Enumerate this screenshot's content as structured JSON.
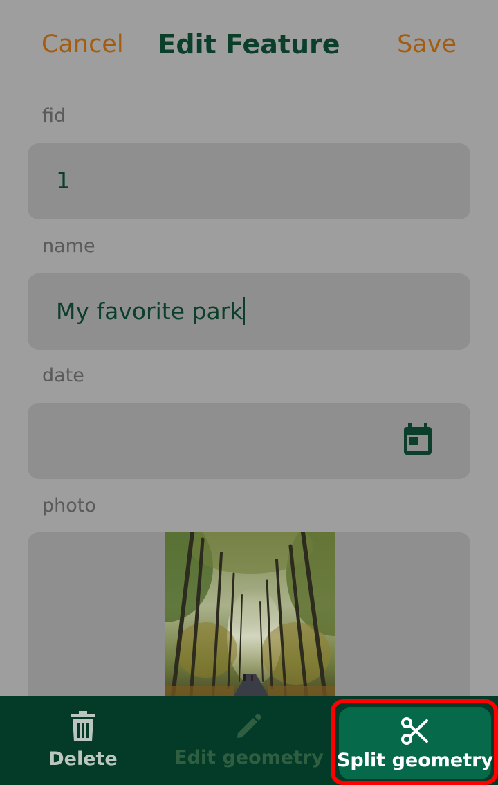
{
  "header": {
    "cancel_label": "Cancel",
    "title": "Edit Feature",
    "save_label": "Save"
  },
  "form": {
    "fid": {
      "label": "fid",
      "value": "1"
    },
    "name": {
      "label": "name",
      "value": "My favorite park"
    },
    "date": {
      "label": "date",
      "value": "",
      "icon": "calendar-icon"
    },
    "photo": {
      "label": "photo",
      "image": "forest-path-photo"
    }
  },
  "toolbar": {
    "delete_label": "Delete",
    "delete_icon": "trash-icon",
    "edit_geometry_label": "Edit geometry",
    "edit_geometry_icon": "pencil-icon",
    "edit_geometry_enabled": false,
    "split_geometry_label": "Split geometry",
    "split_geometry_icon": "scissors-icon"
  },
  "colors": {
    "accent": "#a35d12",
    "primary_dark": "#033b28",
    "primary": "#066a4a",
    "highlight": "#ff0000"
  }
}
